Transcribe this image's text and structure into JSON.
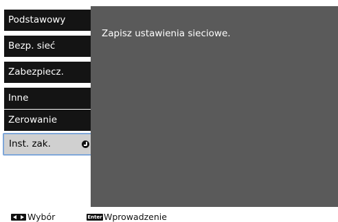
{
  "menu": {
    "items": [
      {
        "label": "Podstawowy"
      },
      {
        "label": "Bezp. sieć"
      },
      {
        "label": "Zabezpiecz."
      },
      {
        "label": "Inne"
      },
      {
        "label": "Zerowanie"
      },
      {
        "label": "Inst. zak.",
        "selected": true,
        "icon": "enter-circle-icon"
      }
    ]
  },
  "panel": {
    "message": "Zapisz ustawienia sieciowe."
  },
  "footer": {
    "select_key_icon": "left-right-arrows-key-icon",
    "select_label": "Wybór",
    "enter_key_label": "Enter",
    "enter_label": "Wprowadzenie"
  },
  "colors": {
    "menu_bg": "#141414",
    "selected_bg": "#d0d0d0",
    "selected_border": "#7ea6d8",
    "panel_bg": "#5a5a5a"
  }
}
